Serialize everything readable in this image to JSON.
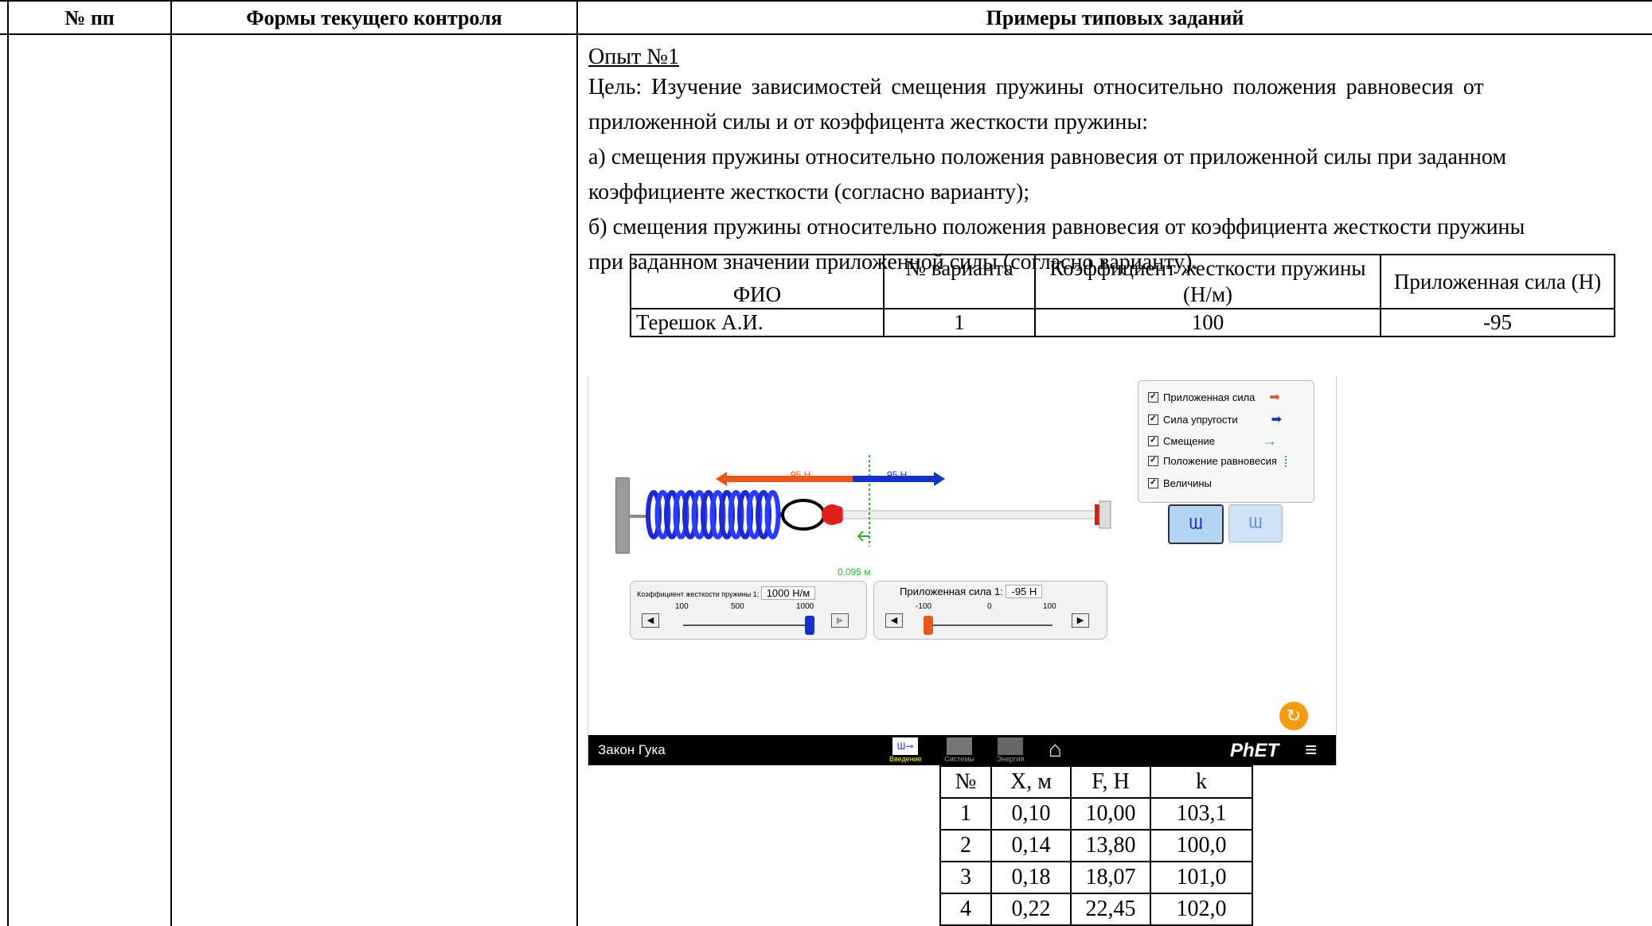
{
  "header": {
    "col1": "№ пп",
    "col2": "Формы текущего контроля",
    "col3": "Примеры типовых заданий"
  },
  "content": {
    "title": "Опыт №1",
    "line1": "Цель: Изучение зависимостей смещения пружины относительно положения равновесия от",
    "line2": "приложенной силы и от коэффицента жесткости пружины:",
    "line3": "а) смещения пружины относительно положения равновесия от приложенной силы при заданном",
    "line4": "коэффициенте жесткости (согласно варианту);",
    "line5": "б) смещения пружины относительно положения равновесия от коэффициента жесткости пружины",
    "line6": "при заданном значении приложенной силы (согласно варианту)."
  },
  "variant_table": {
    "headers": [
      "ФИО",
      "№ варианта",
      "Коэффициент жесткости пружины (Н/м)",
      "Приложенная сила (Н)"
    ],
    "row": [
      "Терешок А.И.",
      "1",
      "100",
      "-95"
    ]
  },
  "sim": {
    "legend": [
      {
        "label": "Приложенная сила",
        "icon": "orange-arrow-icon"
      },
      {
        "label": "Сила упругости",
        "icon": "blue-arrow-icon"
      },
      {
        "label": "Смещение",
        "icon": "green-arrow-icon"
      },
      {
        "label": "Положение равновесия",
        "icon": "green-dotted-line-icon"
      },
      {
        "label": "Величины",
        "icon": ""
      }
    ],
    "applied_label": "95 Н",
    "elastic_label": "95 Н",
    "displacement_label": "0.095 м",
    "stiffness_panel": {
      "label": "Коэффициент жесткости пружины 1:",
      "value": "1000 Н/м",
      "ticks": [
        "100",
        "500",
        "1000"
      ],
      "level": 1.0
    },
    "force_panel": {
      "label": "Приложенная сила 1:",
      "value": "-95 Н",
      "ticks": [
        "-100",
        "0",
        "100"
      ],
      "level": 0.025
    },
    "navbar": {
      "title": "Закон Гука",
      "tabs": [
        "Введение",
        "Системы",
        "Энергия"
      ],
      "brand": "PhET"
    },
    "colors": {
      "applied": "#e8581c",
      "elastic": "#1432c8",
      "displacement": "#28b428"
    }
  },
  "results_table": {
    "headers": [
      "№",
      "X, м",
      "F, Н",
      "k"
    ],
    "rows": [
      [
        "1",
        "0,10",
        "10,00",
        "103,1"
      ],
      [
        "2",
        "0,14",
        "13,80",
        "100,0"
      ],
      [
        "3",
        "0,18",
        "18,07",
        "101,0"
      ],
      [
        "4",
        "0,22",
        "22,45",
        "102,0"
      ]
    ]
  }
}
